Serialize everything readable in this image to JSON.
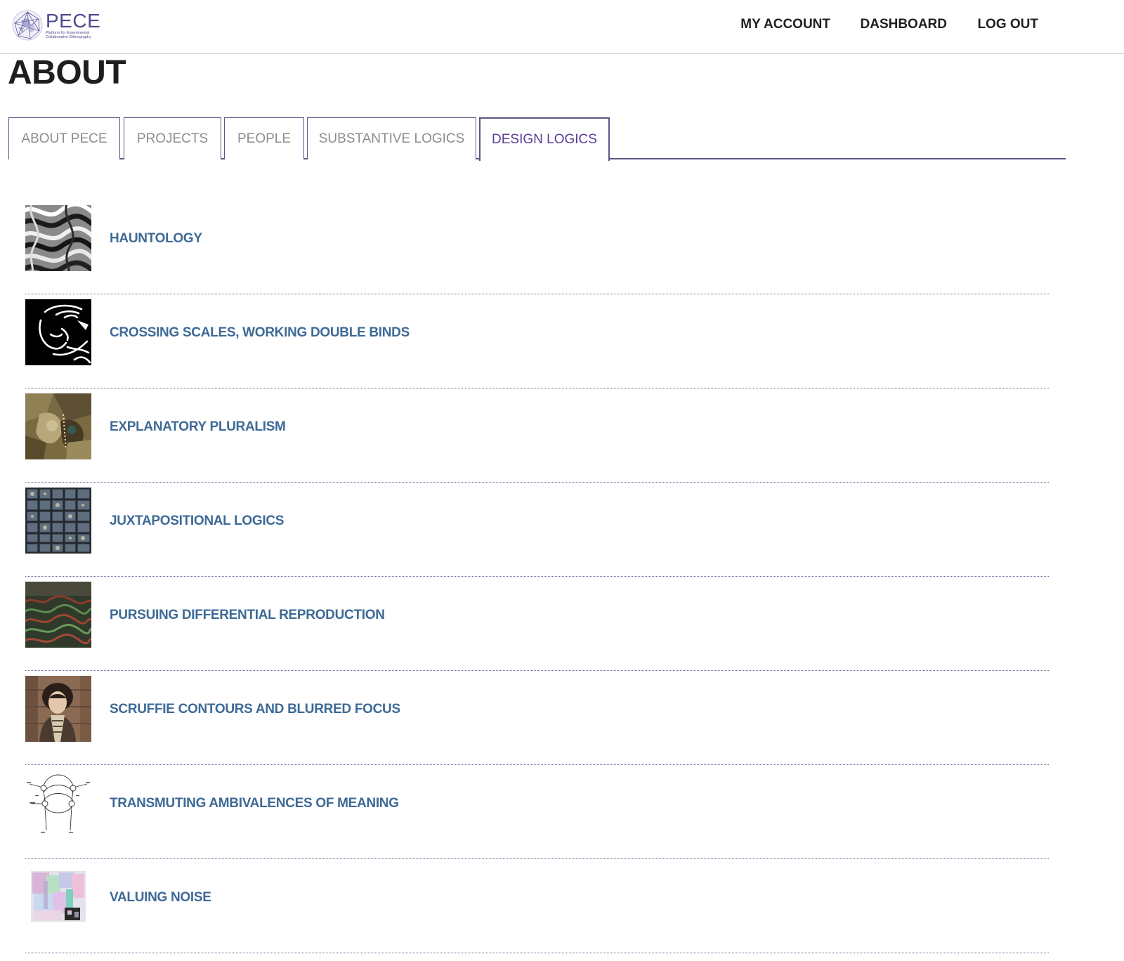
{
  "header": {
    "logo": {
      "name": "PECE",
      "subtitle_line1": "Platform for Experimental",
      "subtitle_line2": "Collaborative Ethnography"
    },
    "nav": [
      {
        "label": "MY ACCOUNT"
      },
      {
        "label": "DASHBOARD"
      },
      {
        "label": "LOG OUT"
      }
    ]
  },
  "page": {
    "title": "ABOUT"
  },
  "tabs": [
    {
      "label": "ABOUT PECE",
      "active": false
    },
    {
      "label": "PROJECTS",
      "active": false
    },
    {
      "label": "PEOPLE",
      "active": false
    },
    {
      "label": "SUBSTANTIVE LOGICS",
      "active": false
    },
    {
      "label": "DESIGN LOGICS",
      "active": true
    }
  ],
  "items": [
    {
      "label": "HAUNTOLOGY",
      "thumbnail": "monochrome-swirl-pattern"
    },
    {
      "label": "CROSSING SCALES, WORKING DOUBLE BINDS",
      "thumbnail": "black-white-face-sketch"
    },
    {
      "label": "EXPLANATORY PLURALISM",
      "thumbnail": "collage-painting"
    },
    {
      "label": "JUXTAPOSITIONAL LOGICS",
      "thumbnail": "grid-of-specimen-boxes"
    },
    {
      "label": "PURSUING DIFFERENTIAL REPRODUCTION",
      "thumbnail": "dark-green-landscape"
    },
    {
      "label": "SCRUFFIE CONTOURS AND BLURRED FOCUS",
      "thumbnail": "portrait-photo"
    },
    {
      "label": "TRANSMUTING AMBIVALENCES OF MEANING",
      "thumbnail": "line-diagram"
    },
    {
      "label": "VALUING NOISE",
      "thumbnail": "pastel-noise-squares"
    }
  ],
  "colors": {
    "brand_purple": "#4d4a8f",
    "active_tab": "#5a3d95",
    "item_link": "#3e6a96",
    "tab_inactive_text": "#8c8c8c"
  }
}
